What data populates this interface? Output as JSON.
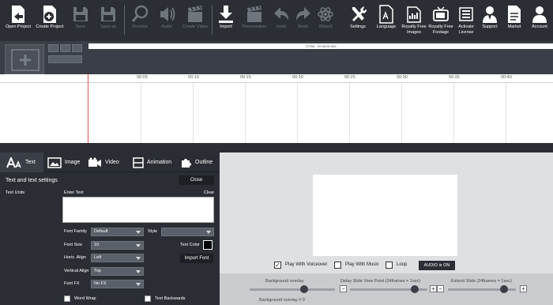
{
  "toolbar": {
    "open_project": "Open Project",
    "create_project": "Create Project",
    "save": "Save",
    "save_as": "Save as",
    "preview": "Preview",
    "audio": "Audio",
    "create_video": "Create Video",
    "import": "Import",
    "presentation": "Presentation",
    "undo": "Undo",
    "redo": "Redo",
    "wizard": "Wizard",
    "settings": "Settings",
    "language": "Language",
    "royalty_free_images": "Royalty Free Images",
    "royalty_free_footage": "Royalty Free Footage",
    "activate_license": "Activate License",
    "support": "Support",
    "market": "Market",
    "account": "Account"
  },
  "timeline": {
    "total": "TOTAL : 00:00:00.000",
    "ticks": [
      "00:05",
      "00:10",
      "00:15",
      "00:20",
      "00:25",
      "00:30",
      "00:35",
      "00:40"
    ]
  },
  "tabs": [
    {
      "label": "Text",
      "icon": "text-icon"
    },
    {
      "label": "Image",
      "icon": "image-icon"
    },
    {
      "label": "Video",
      "icon": "video-icon"
    },
    {
      "label": "Animation",
      "icon": "animation-icon"
    },
    {
      "label": "Outline",
      "icon": "puzzle-icon"
    }
  ],
  "panel": {
    "title": "Text and text settings",
    "close": "Close",
    "text_units": "Text Units",
    "enter_text": "Enter Text",
    "clear": "Clear",
    "font_family_label": "Font Family",
    "font_family_value": "Default",
    "style_label": "Style",
    "style_value": "",
    "font_size_label": "Font Size",
    "font_size_value": "10",
    "text_color_label": "Text Color",
    "horiz_align_label": "Horiz. Align",
    "horiz_align_value": "Left",
    "import_font": "Import Font",
    "vertical_align_label": "Vertical Align",
    "vertical_align_value": "Top",
    "font_fx_label": "Font FX",
    "font_fx_value": "No FX",
    "word_wrap": "Word Wrap",
    "text_backwards": "Text Backwards",
    "text_color_hex": "#000000"
  },
  "preview_options": {
    "play_with_voiceover": "Play With Voiceover",
    "play_with_voiceover_checked": true,
    "play_with_music": "Play With Music",
    "loop": "Loop",
    "audio_is_on": "AUDIO is ON"
  },
  "sliders": {
    "background_overlay": "Background overlay",
    "background_overlay_value": "Background overlay # 0",
    "delay_slide": "Delay Slide View Point (24frames = 1sec)",
    "extend_slide": "Extend Slide (24frames = 1sec)"
  },
  "colors": {
    "toolbar_bg": "#2b2f35",
    "panel_bg": "#2a2e34",
    "preview_bg": "#dfe0e2",
    "playhead": "#e05050"
  }
}
